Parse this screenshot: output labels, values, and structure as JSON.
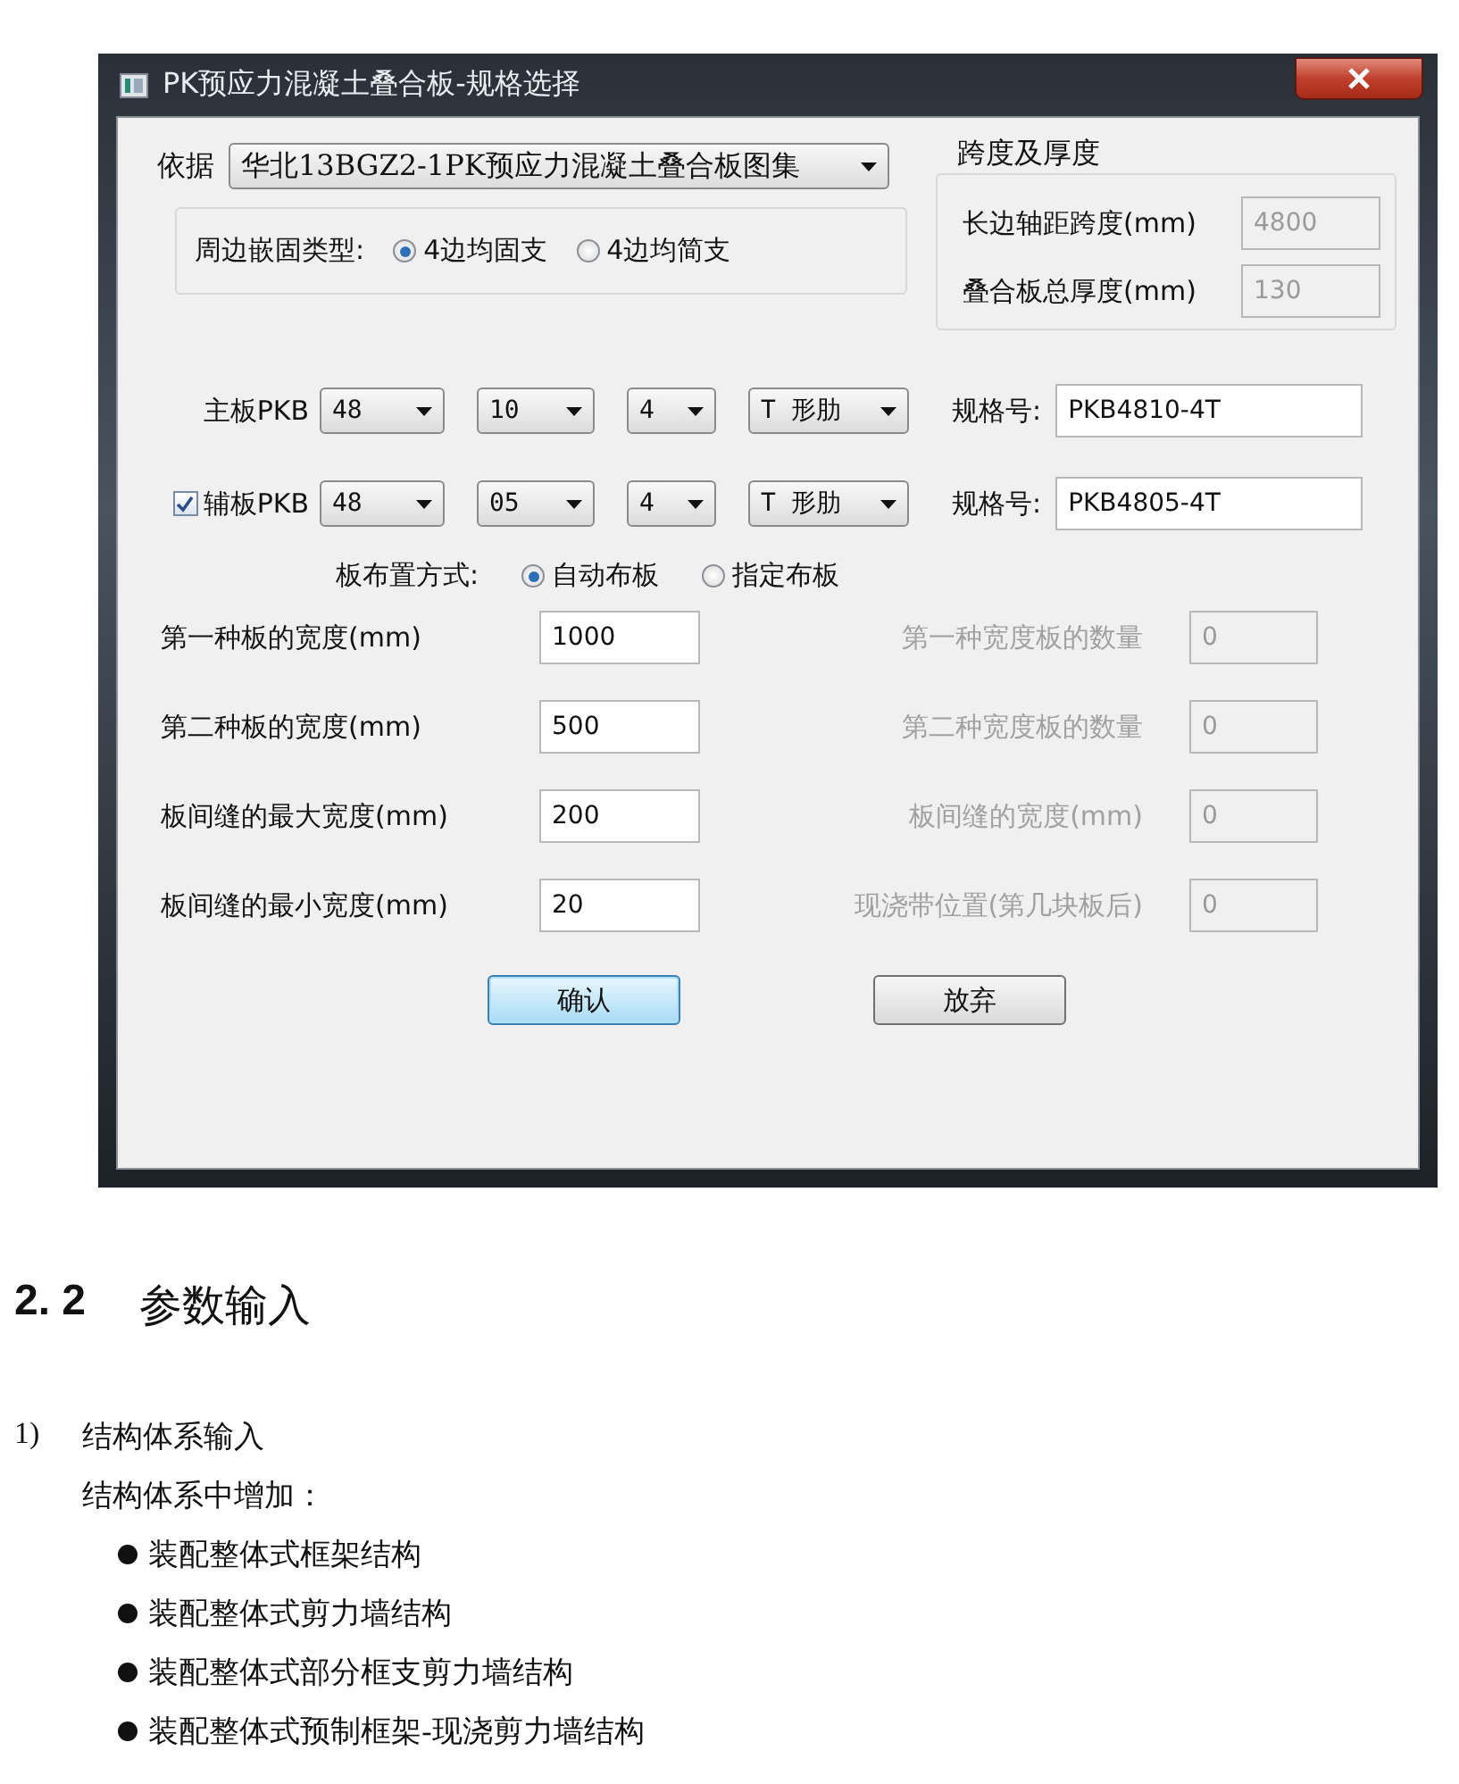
{
  "window": {
    "title": "PK预应力混凝土叠合板-规格选择"
  },
  "basis": {
    "label": "依据",
    "value": "华北13BGZ2-1PK预应力混凝土叠合板图集"
  },
  "edge_type": {
    "label": "周边嵌固类型:",
    "options": [
      {
        "label": "4边均固支",
        "selected": true
      },
      {
        "label": "4边均简支",
        "selected": false
      }
    ]
  },
  "span_group": {
    "title": "跨度及厚度",
    "fields": [
      {
        "label": "长边轴距跨度(mm)",
        "value": "4800",
        "disabled": true
      },
      {
        "label": "叠合板总厚度(mm)",
        "value": "130",
        "disabled": true
      }
    ]
  },
  "main_slab": {
    "label": "主板PKB",
    "selects": [
      "48",
      "10",
      "4",
      "T 形肋"
    ],
    "spec_label": "规格号:",
    "spec_value": "PKB4810-4T"
  },
  "sub_slab": {
    "checked": true,
    "label": "辅板PKB",
    "selects": [
      "48",
      "05",
      "4",
      "T 形肋"
    ],
    "spec_label": "规格号:",
    "spec_value": "PKB4805-4T"
  },
  "layout_mode": {
    "label": "板布置方式:",
    "options": [
      {
        "label": "自动布板",
        "selected": true
      },
      {
        "label": "指定布板",
        "selected": false
      }
    ]
  },
  "params": [
    {
      "label": "第一种板的宽度(mm)",
      "value": "1000"
    },
    {
      "label": "第二种板的宽度(mm)",
      "value": "500"
    },
    {
      "label": "板间缝的最大宽度(mm)",
      "value": "200"
    },
    {
      "label": "板间缝的最小宽度(mm)",
      "value": "20"
    }
  ],
  "results": [
    {
      "label": "第一种宽度板的数量",
      "value": "0",
      "disabled": true
    },
    {
      "label": "第二种宽度板的数量",
      "value": "0",
      "disabled": true
    },
    {
      "label": "板间缝的宽度(mm)",
      "value": "0",
      "disabled": true
    },
    {
      "label": "现浇带位置(第几块板后)",
      "value": "0",
      "disabled": true
    }
  ],
  "buttons": [
    {
      "label": "确认",
      "default": true
    },
    {
      "label": "放弃",
      "default": false
    }
  ],
  "document": {
    "section_number": "2. 2",
    "section_title": "参数输入",
    "item_number": "1)",
    "item_title": "结构体系输入",
    "intro": "结构体系中增加：",
    "bullets": [
      "装配整体式框架结构",
      "装配整体式剪力墙结构",
      "装配整体式部分框支剪力墙结构",
      "装配整体式预制框架-现浇剪力墙结构"
    ]
  }
}
